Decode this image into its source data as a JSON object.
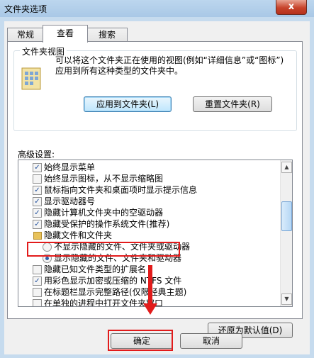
{
  "window": {
    "title": "文件夹选项",
    "close_label": "x"
  },
  "tabs": [
    {
      "label": "常规"
    },
    {
      "label": "查看"
    },
    {
      "label": "搜索"
    }
  ],
  "folder_view": {
    "group_label": "文件夹视图",
    "description": "可以将这个文件夹正在使用的视图(例如“详细信息”或“图标”)应用到所有这种类型的文件夹中。",
    "apply_button": "应用到文件夹(L)",
    "reset_button": "重置文件夹(R)"
  },
  "advanced": {
    "label": "高级设置:",
    "items": [
      {
        "type": "checkbox",
        "checked": true,
        "label": "始终显示菜单"
      },
      {
        "type": "checkbox",
        "checked": false,
        "label": "始终显示图标，从不显示缩略图"
      },
      {
        "type": "checkbox",
        "checked": true,
        "label": "鼠标指向文件夹和桌面项时显示提示信息"
      },
      {
        "type": "checkbox",
        "checked": true,
        "label": "显示驱动器号"
      },
      {
        "type": "checkbox",
        "checked": true,
        "label": "隐藏计算机文件夹中的空驱动器"
      },
      {
        "type": "checkbox",
        "checked": true,
        "label": "隐藏受保护的操作系统文件(推荐)"
      },
      {
        "type": "folder",
        "label": "隐藏文件和文件夹"
      },
      {
        "type": "radio",
        "checked": false,
        "label": "不显示隐藏的文件、文件夹或驱动器"
      },
      {
        "type": "radio",
        "checked": true,
        "label": "显示隐藏的文件、文件夹和驱动器"
      },
      {
        "type": "checkbox",
        "checked": false,
        "label": "隐藏已知文件类型的扩展名"
      },
      {
        "type": "checkbox",
        "checked": true,
        "label": "用彩色显示加密或压缩的 NTFS 文件"
      },
      {
        "type": "checkbox",
        "checked": false,
        "label": "在标题栏显示完整路径(仅限经典主题)"
      },
      {
        "type": "checkbox",
        "checked": false,
        "label": "在单独的进程中打开文件夹窗口"
      }
    ],
    "restore_button": "还原为默认值(D)"
  },
  "footer": {
    "ok_button": "确定",
    "cancel_button": "取消"
  },
  "colors": {
    "highlight": "#e21b1b"
  }
}
